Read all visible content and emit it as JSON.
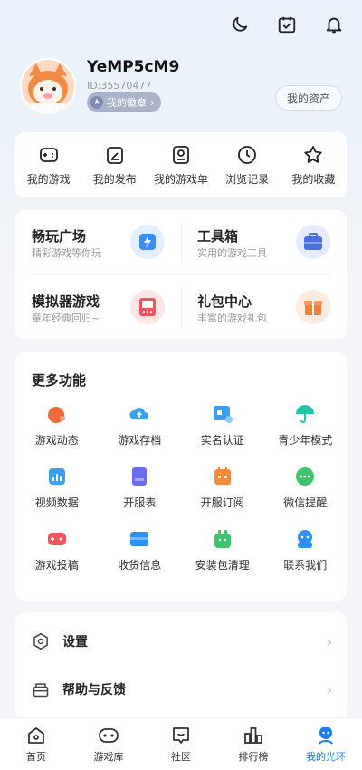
{
  "header": {
    "icons": [
      "moon-icon",
      "calendar-check-icon",
      "bell-icon"
    ]
  },
  "profile": {
    "username": "YeMP5cM9",
    "id_text": "ID:35570477",
    "badge_label": "我的徽章",
    "assets_label": "我的资产"
  },
  "quick": [
    {
      "label": "我的游戏",
      "icon": "gamepad-icon"
    },
    {
      "label": "我的发布",
      "icon": "edit-icon"
    },
    {
      "label": "我的游戏单",
      "icon": "game-list-icon"
    },
    {
      "label": "浏览记录",
      "icon": "clock-icon"
    },
    {
      "label": "我的收藏",
      "icon": "star-icon"
    }
  ],
  "featured": [
    {
      "title": "畅玩广场",
      "subtitle": "精彩游戏等你玩",
      "icon": "lightning-icon",
      "color": "#3b8cf5"
    },
    {
      "title": "工具箱",
      "subtitle": "实用的游戏工具",
      "icon": "toolbox-icon",
      "color": "#4a6fe3"
    },
    {
      "title": "模拟器游戏",
      "subtitle": "童年经典回归~",
      "icon": "emulator-icon",
      "color": "#f0545d"
    },
    {
      "title": "礼包中心",
      "subtitle": "丰富的游戏礼包",
      "icon": "gift-icon",
      "color": "#f57d3c"
    }
  ],
  "more": {
    "title": "更多功能",
    "items": [
      {
        "label": "游戏动态",
        "icon": "dynamic-icon",
        "color": "#f26b3a"
      },
      {
        "label": "游戏存档",
        "icon": "cloud-upload-icon",
        "color": "#3aa0f2"
      },
      {
        "label": "实名认证",
        "icon": "id-card-icon",
        "color": "#3a9ff2"
      },
      {
        "label": "青少年模式",
        "icon": "umbrella-icon",
        "color": "#22c3a8"
      },
      {
        "label": "视频数据",
        "icon": "video-data-icon",
        "color": "#3aa0f2"
      },
      {
        "label": "开服表",
        "icon": "server-table-icon",
        "color": "#6c6cf0"
      },
      {
        "label": "开服订阅",
        "icon": "subscribe-icon",
        "color": "#f58a3a"
      },
      {
        "label": "微信提醒",
        "icon": "wechat-icon",
        "color": "#3ec46d"
      },
      {
        "label": "游戏投稿",
        "icon": "game-submit-icon",
        "color": "#f0545d"
      },
      {
        "label": "收货信息",
        "icon": "address-icon",
        "color": "#2f8ff2"
      },
      {
        "label": "安装包清理",
        "icon": "clean-icon",
        "color": "#3ec46d"
      },
      {
        "label": "联系我们",
        "icon": "service-icon",
        "color": "#2f8ff2"
      }
    ]
  },
  "settings": [
    {
      "label": "设置",
      "icon": "settings-icon"
    },
    {
      "label": "帮助与反馈",
      "icon": "help-icon"
    }
  ],
  "tabs": [
    {
      "label": "首页",
      "icon": "home-icon",
      "active": false
    },
    {
      "label": "游戏库",
      "icon": "game-library-icon",
      "active": false
    },
    {
      "label": "社区",
      "icon": "community-icon",
      "active": false
    },
    {
      "label": "排行榜",
      "icon": "ranking-icon",
      "active": false
    },
    {
      "label": "我的光环",
      "icon": "profile-icon",
      "active": true
    }
  ],
  "colors": {
    "accent": "#1a7ef5",
    "badge": "#aab3c9"
  }
}
